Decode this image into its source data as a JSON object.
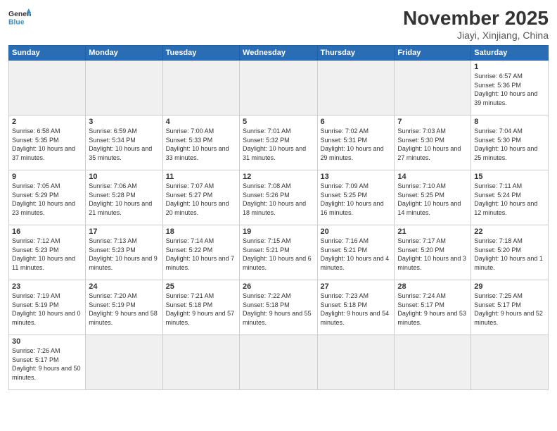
{
  "header": {
    "logo_general": "General",
    "logo_blue": "Blue",
    "month_title": "November 2025",
    "location": "Jiayi, Xinjiang, China"
  },
  "days_of_week": [
    "Sunday",
    "Monday",
    "Tuesday",
    "Wednesday",
    "Thursday",
    "Friday",
    "Saturday"
  ],
  "weeks": [
    [
      {
        "day": "",
        "empty": true
      },
      {
        "day": "",
        "empty": true
      },
      {
        "day": "",
        "empty": true
      },
      {
        "day": "",
        "empty": true
      },
      {
        "day": "",
        "empty": true
      },
      {
        "day": "",
        "empty": true
      },
      {
        "day": "1",
        "sunrise": "6:57 AM",
        "sunset": "5:36 PM",
        "daylight": "10 hours and 39 minutes."
      }
    ],
    [
      {
        "day": "2",
        "sunrise": "6:58 AM",
        "sunset": "5:35 PM",
        "daylight": "10 hours and 37 minutes."
      },
      {
        "day": "3",
        "sunrise": "6:59 AM",
        "sunset": "5:34 PM",
        "daylight": "10 hours and 35 minutes."
      },
      {
        "day": "4",
        "sunrise": "7:00 AM",
        "sunset": "5:33 PM",
        "daylight": "10 hours and 33 minutes."
      },
      {
        "day": "5",
        "sunrise": "7:01 AM",
        "sunset": "5:32 PM",
        "daylight": "10 hours and 31 minutes."
      },
      {
        "day": "6",
        "sunrise": "7:02 AM",
        "sunset": "5:31 PM",
        "daylight": "10 hours and 29 minutes."
      },
      {
        "day": "7",
        "sunrise": "7:03 AM",
        "sunset": "5:30 PM",
        "daylight": "10 hours and 27 minutes."
      },
      {
        "day": "8",
        "sunrise": "7:04 AM",
        "sunset": "5:30 PM",
        "daylight": "10 hours and 25 minutes."
      }
    ],
    [
      {
        "day": "9",
        "sunrise": "7:05 AM",
        "sunset": "5:29 PM",
        "daylight": "10 hours and 23 minutes."
      },
      {
        "day": "10",
        "sunrise": "7:06 AM",
        "sunset": "5:28 PM",
        "daylight": "10 hours and 21 minutes."
      },
      {
        "day": "11",
        "sunrise": "7:07 AM",
        "sunset": "5:27 PM",
        "daylight": "10 hours and 20 minutes."
      },
      {
        "day": "12",
        "sunrise": "7:08 AM",
        "sunset": "5:26 PM",
        "daylight": "10 hours and 18 minutes."
      },
      {
        "day": "13",
        "sunrise": "7:09 AM",
        "sunset": "5:25 PM",
        "daylight": "10 hours and 16 minutes."
      },
      {
        "day": "14",
        "sunrise": "7:10 AM",
        "sunset": "5:25 PM",
        "daylight": "10 hours and 14 minutes."
      },
      {
        "day": "15",
        "sunrise": "7:11 AM",
        "sunset": "5:24 PM",
        "daylight": "10 hours and 12 minutes."
      }
    ],
    [
      {
        "day": "16",
        "sunrise": "7:12 AM",
        "sunset": "5:23 PM",
        "daylight": "10 hours and 11 minutes."
      },
      {
        "day": "17",
        "sunrise": "7:13 AM",
        "sunset": "5:23 PM",
        "daylight": "10 hours and 9 minutes."
      },
      {
        "day": "18",
        "sunrise": "7:14 AM",
        "sunset": "5:22 PM",
        "daylight": "10 hours and 7 minutes."
      },
      {
        "day": "19",
        "sunrise": "7:15 AM",
        "sunset": "5:21 PM",
        "daylight": "10 hours and 6 minutes."
      },
      {
        "day": "20",
        "sunrise": "7:16 AM",
        "sunset": "5:21 PM",
        "daylight": "10 hours and 4 minutes."
      },
      {
        "day": "21",
        "sunrise": "7:17 AM",
        "sunset": "5:20 PM",
        "daylight": "10 hours and 3 minutes."
      },
      {
        "day": "22",
        "sunrise": "7:18 AM",
        "sunset": "5:20 PM",
        "daylight": "10 hours and 1 minute."
      }
    ],
    [
      {
        "day": "23",
        "sunrise": "7:19 AM",
        "sunset": "5:19 PM",
        "daylight": "10 hours and 0 minutes."
      },
      {
        "day": "24",
        "sunrise": "7:20 AM",
        "sunset": "5:19 PM",
        "daylight": "9 hours and 58 minutes."
      },
      {
        "day": "25",
        "sunrise": "7:21 AM",
        "sunset": "5:18 PM",
        "daylight": "9 hours and 57 minutes."
      },
      {
        "day": "26",
        "sunrise": "7:22 AM",
        "sunset": "5:18 PM",
        "daylight": "9 hours and 55 minutes."
      },
      {
        "day": "27",
        "sunrise": "7:23 AM",
        "sunset": "5:18 PM",
        "daylight": "9 hours and 54 minutes."
      },
      {
        "day": "28",
        "sunrise": "7:24 AM",
        "sunset": "5:17 PM",
        "daylight": "9 hours and 53 minutes."
      },
      {
        "day": "29",
        "sunrise": "7:25 AM",
        "sunset": "5:17 PM",
        "daylight": "9 hours and 52 minutes."
      }
    ],
    [
      {
        "day": "30",
        "sunrise": "7:26 AM",
        "sunset": "5:17 PM",
        "daylight": "9 hours and 50 minutes."
      },
      {
        "day": "",
        "empty": true
      },
      {
        "day": "",
        "empty": true
      },
      {
        "day": "",
        "empty": true
      },
      {
        "day": "",
        "empty": true
      },
      {
        "day": "",
        "empty": true
      },
      {
        "day": "",
        "empty": true
      }
    ]
  ]
}
